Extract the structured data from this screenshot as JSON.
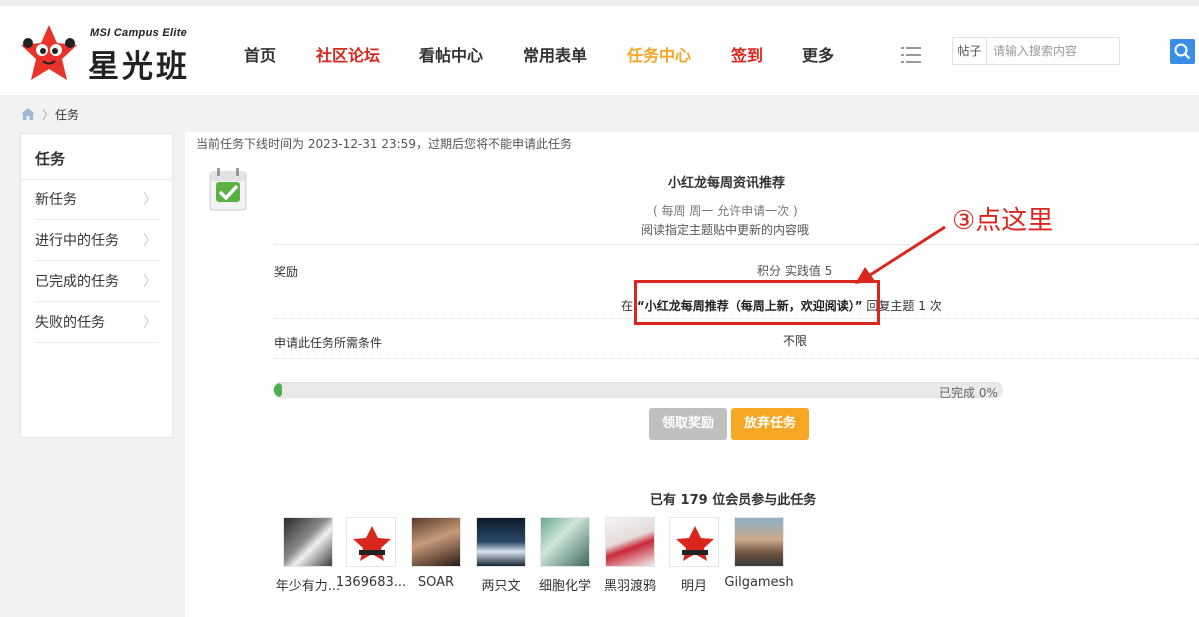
{
  "header": {
    "logo_en": "MSI Campus Elite",
    "logo_cn": "星光班",
    "nav": [
      {
        "label": "首页",
        "color": "#333333"
      },
      {
        "label": "社区论坛",
        "color": "#d9271e"
      },
      {
        "label": "看帖中心",
        "color": "#333333"
      },
      {
        "label": "常用表单",
        "color": "#333333"
      },
      {
        "label": "任务中心",
        "color": "#f5a623"
      },
      {
        "label": "签到",
        "color": "#d9271e"
      },
      {
        "label": "更多",
        "color": "#333333"
      }
    ],
    "search": {
      "scope": "帖子",
      "placeholder": "请输入搜索内容"
    }
  },
  "breadcrumb": {
    "current": "任务"
  },
  "sidebar": {
    "title": "任务",
    "items": [
      {
        "label": "新任务"
      },
      {
        "label": "进行中的任务"
      },
      {
        "label": "已完成的任务"
      },
      {
        "label": "失败的任务"
      }
    ]
  },
  "task": {
    "notice": "当前任务下线时间为 2023-12-31 23:59，过期后您将不能申请此任务",
    "title": "小红龙每周资讯推荐",
    "frequency": "( 每周 周一 允许申请一次 )",
    "description": "阅读指定主题贴中更新的内容哦",
    "reward_label": "奖励",
    "reward_value": "积分 实践值 5",
    "condition_prefix": "在 ",
    "condition_link": "“小红龙每周推荐（每周上新，欢迎阅读）”",
    "condition_suffix": " 回复主题 1 次",
    "requirement_label": "申请此任务所需条件",
    "requirement_value": "不限",
    "progress_percent": 0,
    "progress_text": "已完成 0%",
    "claim_button": "领取奖励",
    "abandon_button": "放弃任务"
  },
  "annotation": {
    "text": "③点这里",
    "color": "#d9271e"
  },
  "members": {
    "title": "已有 179 位会员参与此任务",
    "list": [
      {
        "name": "年少有力..."
      },
      {
        "name": "1369683..."
      },
      {
        "name": "SOAR"
      },
      {
        "name": "两只文"
      },
      {
        "name": "细胞化学"
      },
      {
        "name": "黑羽渡鸦"
      },
      {
        "name": "明月"
      },
      {
        "name": "Gilgamesh"
      }
    ]
  }
}
